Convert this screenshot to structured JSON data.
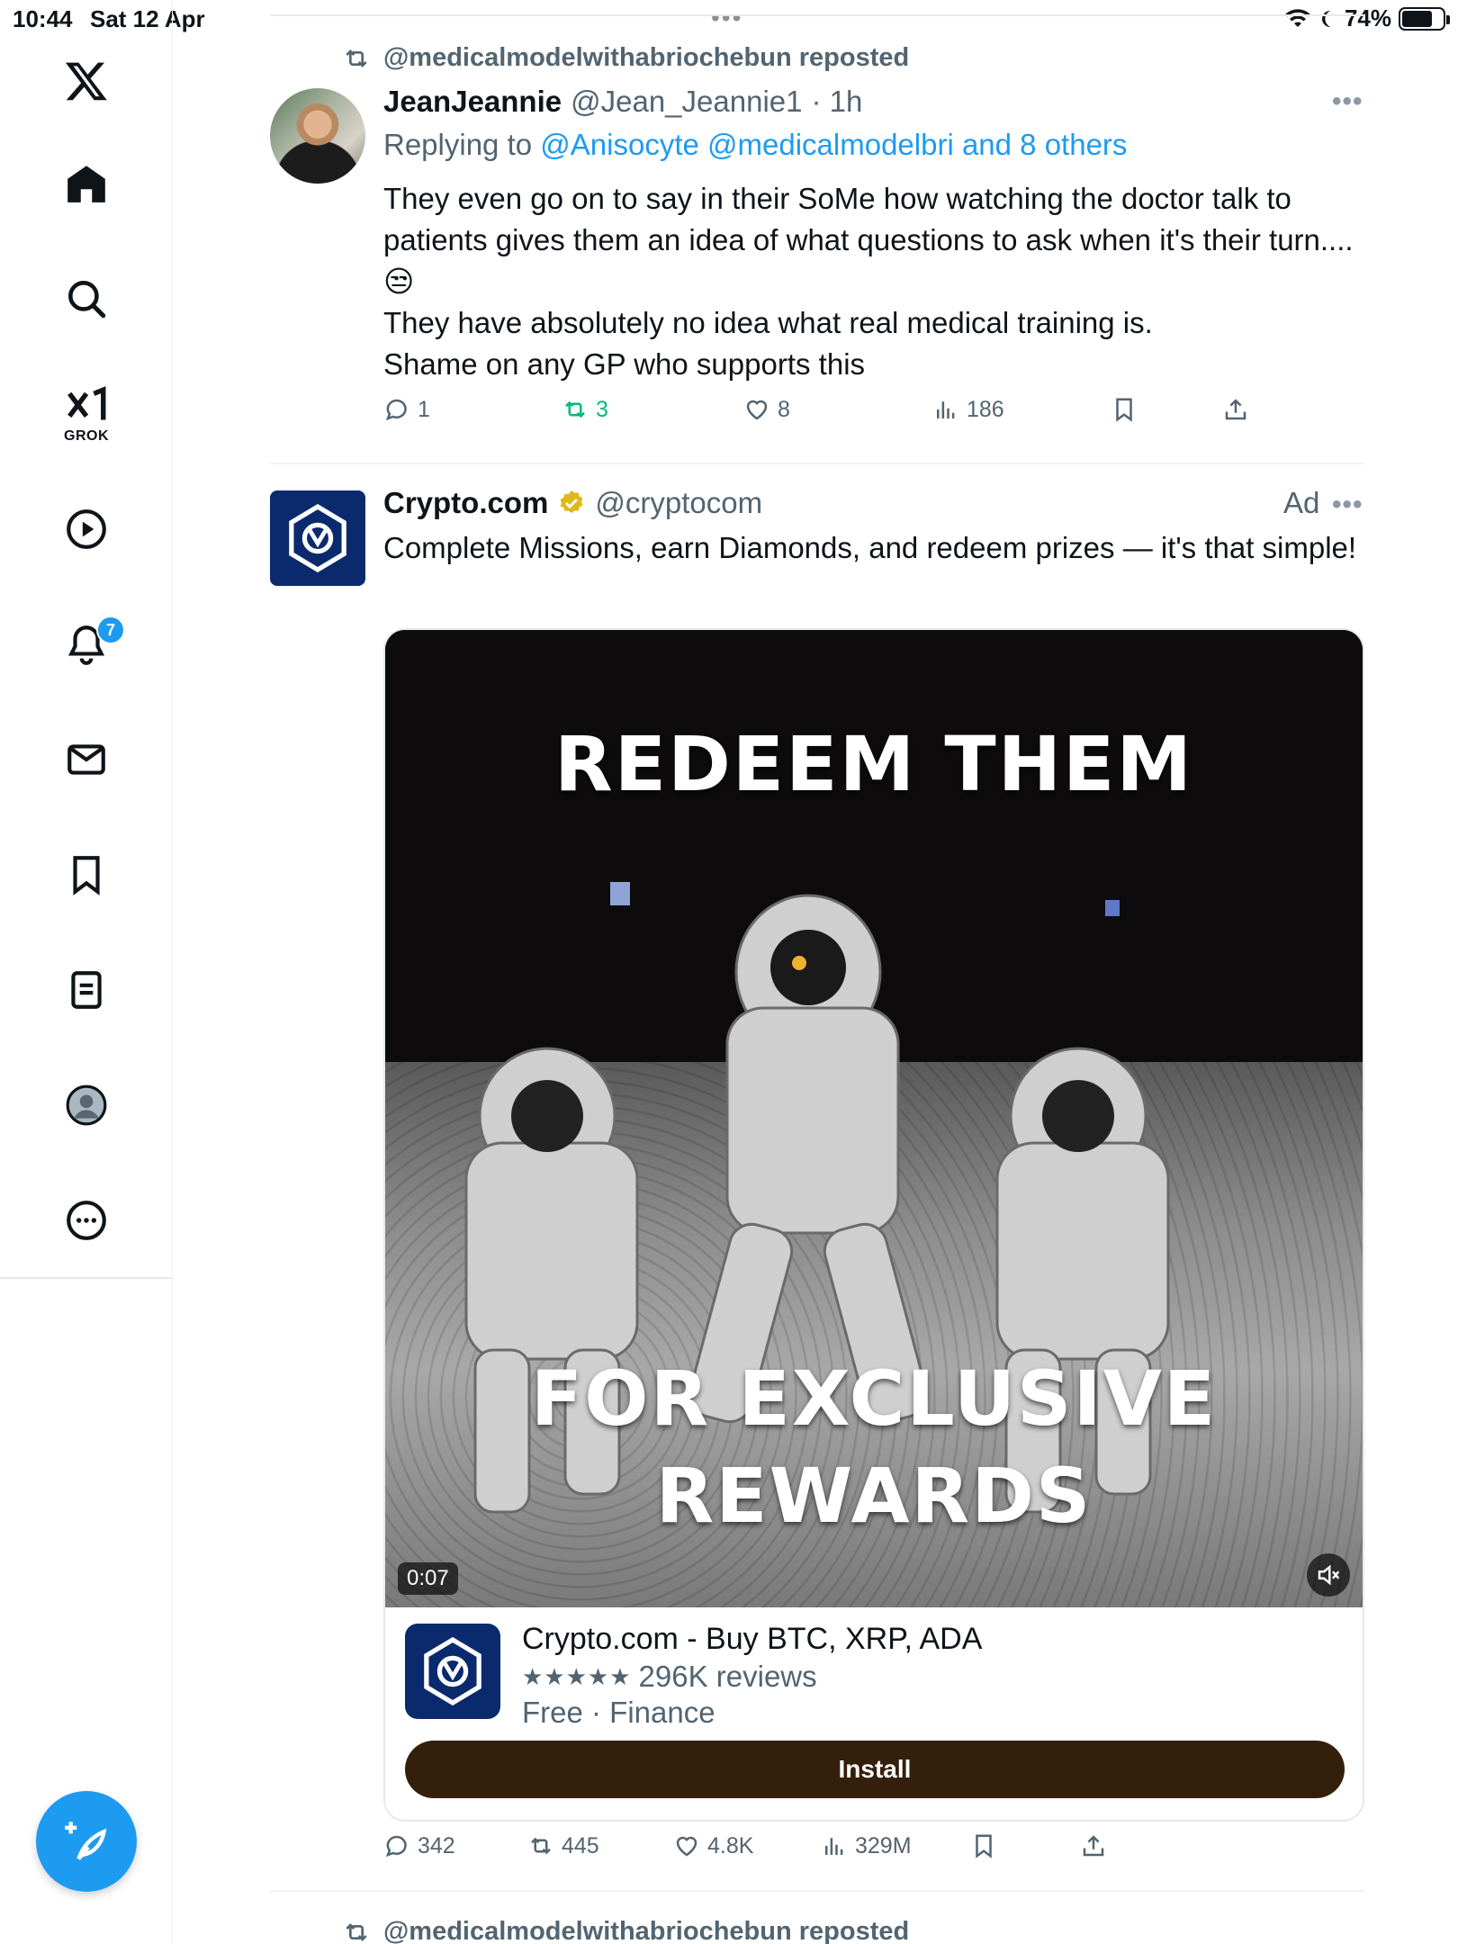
{
  "status_bar": {
    "time": "10:44",
    "date": "Sat 12 Apr",
    "battery_text": "74%",
    "battery_level": 0.74
  },
  "sidebar": {
    "grok_label": "GROK",
    "notifications_badge": "7",
    "items": [
      "x-logo",
      "home-icon",
      "search-icon",
      "grok-icon",
      "video-icon",
      "notifications-icon",
      "messages-icon",
      "bookmarks-icon",
      "lists-icon",
      "profile-icon",
      "more-icon"
    ],
    "accent_color": "#1d9bf0"
  },
  "post1": {
    "repost_text": "@medicalmodelwithabriochebun reposted",
    "name": "JeanJeannie",
    "handle": "@Jean_Jeannie1",
    "time": "· 1h",
    "reply_prefix": "Replying to",
    "reply_targets": "@Anisocyte @medicalmodelbri and 8 others",
    "text_lines": [
      "They even go on to say in their SoMe how watching the doctor talk to patients gives them an idea of what questions to ask when it's their turn....😒",
      "They have absolutely no idea what real medical training is.",
      "Shame on any GP who supports this"
    ],
    "replies": "1",
    "reposts": "3",
    "likes": "8",
    "views": "186"
  },
  "post2": {
    "name": "Crypto.com",
    "handle": "@cryptocom",
    "ad_label": "Ad",
    "text": "Complete Missions, earn Diamonds, and redeem prizes — it's that simple!",
    "video": {
      "headline_top": "REDEEM THEM",
      "headline_bottom": "FOR EXCLUSIVE\nREWARDS",
      "timer": "0:07"
    },
    "app_card": {
      "title": "Crypto.com - Buy BTC, XRP, ADA",
      "stars": "★★★★★",
      "rating_value": 4.5,
      "reviews": "296K reviews",
      "meta": "Free · Finance",
      "install_label": "Install",
      "button_color": "#341f0d"
    },
    "replies": "342",
    "reposts": "445",
    "likes": "4.8K",
    "views": "329M"
  },
  "post3": {
    "repost_text": "@medicalmodelwithabriochebun reposted"
  }
}
